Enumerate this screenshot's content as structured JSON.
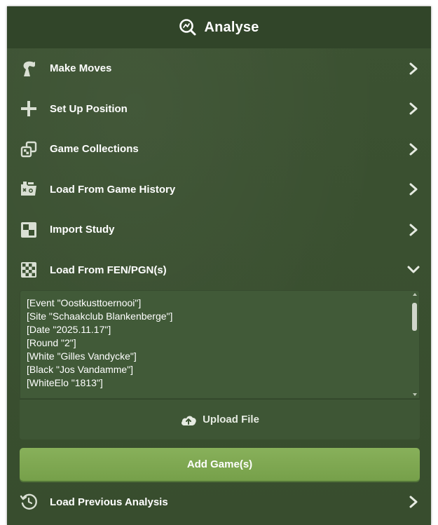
{
  "header": {
    "title": "Analyse",
    "icon": "analysis-magnifier-icon"
  },
  "menu": [
    {
      "label": "Make Moves",
      "icon": "knight-icon"
    },
    {
      "label": "Set Up Position",
      "icon": "plus-icon"
    },
    {
      "label": "Game Collections",
      "icon": "collections-icon"
    },
    {
      "label": "Load From Game History",
      "icon": "history-folder-icon"
    },
    {
      "label": "Import Study",
      "icon": "board-icon"
    },
    {
      "label": "Load From FEN/PGN(s)",
      "icon": "checker-icon",
      "expanded": true
    }
  ],
  "fen_pgn": {
    "text": "[Event \"Oostkusttoernooi\"]\n[Site \"Schaakclub Blankenberge\"]\n[Date \"2025.11.17\"]\n[Round \"2\"]\n[White \"Gilles Vandycke\"]\n[Black \"Jos Vandamme\"]\n[WhiteElo \"1813\"]"
  },
  "upload": {
    "label": "Upload File",
    "icon": "cloud-upload-icon"
  },
  "add_button": {
    "label": "Add Game(s)"
  },
  "previous": {
    "label": "Load Previous Analysis",
    "icon": "history-icon"
  },
  "colors": {
    "accent": "#7fa650",
    "panel": "#3a5030",
    "header": "#314529"
  }
}
